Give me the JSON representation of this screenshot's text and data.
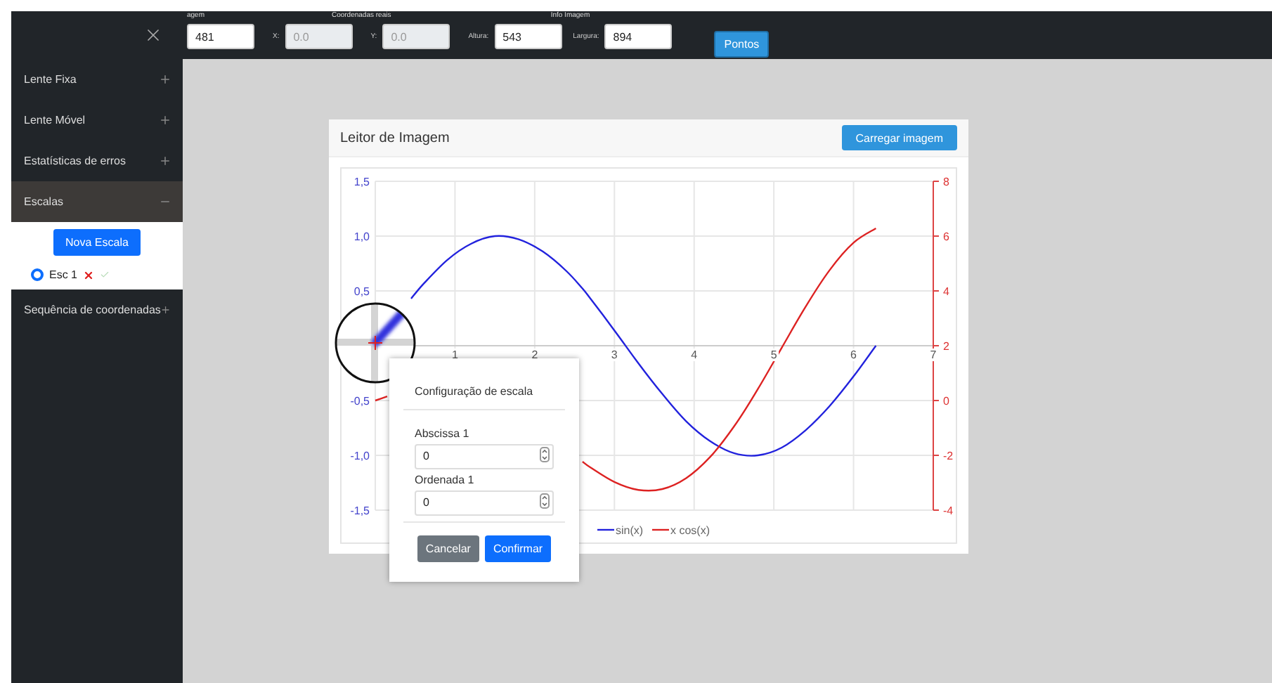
{
  "toolbar": {
    "image_section": {
      "label": "agem",
      "value": "481"
    },
    "real_coords": {
      "label": "Coordenadas reais",
      "fields": [
        {
          "label": "X:",
          "value": "0.0",
          "disabled": true
        },
        {
          "label": "Y:",
          "value": "0.0",
          "disabled": true
        }
      ]
    },
    "image_info": {
      "label": "Info Imagem",
      "fields": [
        {
          "label": "Altura:",
          "value": "543",
          "disabled": false
        },
        {
          "label": "Largura:",
          "value": "894",
          "disabled": false
        }
      ]
    },
    "points_button": "Pontos"
  },
  "sidebar": {
    "items": [
      {
        "label": "Lente Fixa",
        "expanded": false
      },
      {
        "label": "Lente Móvel",
        "expanded": false
      },
      {
        "label": "Estatísticas de erros",
        "expanded": false
      },
      {
        "label": "Escalas",
        "expanded": true,
        "new_button": "Nova Escala",
        "scales": [
          {
            "label": "Esc 1",
            "selected": true
          }
        ]
      },
      {
        "label": "Sequência de coordenadas",
        "expanded": false
      }
    ]
  },
  "card": {
    "title": "Leitor de Imagem",
    "load_button": "Carregar imagem",
    "chart_data": {
      "type": "line",
      "x": [
        0,
        0.15,
        0.3,
        0.45,
        0.6,
        0.9,
        1.2,
        1.5,
        1.8,
        2.1,
        2.4,
        2.6,
        2.7,
        3.0,
        3.3,
        3.6,
        3.9,
        4.2,
        4.5,
        4.8,
        5.1,
        5.4,
        5.7,
        6.0,
        6.28
      ],
      "series": [
        {
          "name": "sin(x)",
          "color": "#2222dd",
          "values": [
            null,
            null,
            null,
            0.43,
            0.56,
            0.78,
            0.93,
            1,
            0.97,
            0.86,
            0.68,
            0.52,
            0.43,
            0.14,
            -0.16,
            -0.44,
            -0.69,
            -0.87,
            -0.98,
            -1,
            -0.93,
            -0.77,
            -0.55,
            -0.28,
            0
          ]
        },
        {
          "name": "x cos(x)",
          "color": "#dd2222",
          "axis": "y2",
          "values": [
            0,
            0.15,
            null,
            null,
            null,
            null,
            null,
            null,
            null,
            null,
            null,
            -2.23,
            -2.44,
            -2.97,
            -3.26,
            -3.23,
            -2.83,
            -2.06,
            -0.95,
            0.42,
            1.93,
            3.43,
            4.76,
            5.76,
            6.28
          ]
        }
      ],
      "xlim": [
        0,
        7
      ],
      "ylim": [
        -1.5,
        1.5
      ],
      "y2lim": [
        -4,
        8
      ],
      "xticks": [
        1,
        2,
        3,
        4,
        5,
        6,
        7
      ],
      "yticks": [
        {
          "value": 1.5,
          "label": "1,5"
        },
        {
          "value": 1,
          "label": "1,0"
        },
        {
          "value": 0.5,
          "label": "0,5"
        },
        {
          "value": -0.5,
          "label": "-0,5"
        },
        {
          "value": -1,
          "label": "-1,0"
        },
        {
          "value": -1.5,
          "label": "-1,5"
        }
      ],
      "y2ticks": [
        8,
        6,
        4,
        2,
        0,
        -2,
        -4
      ],
      "grid": true,
      "legend": true
    }
  },
  "dialog": {
    "title": "Configuração de escala",
    "fields": [
      {
        "label": "Abscissa 1",
        "value": "0"
      },
      {
        "label": "Ordenada 1",
        "value": "0"
      }
    ],
    "buttons": [
      {
        "label": "Cancelar",
        "kind": "secondary"
      },
      {
        "label": "Confirmar",
        "kind": "primary"
      }
    ]
  }
}
